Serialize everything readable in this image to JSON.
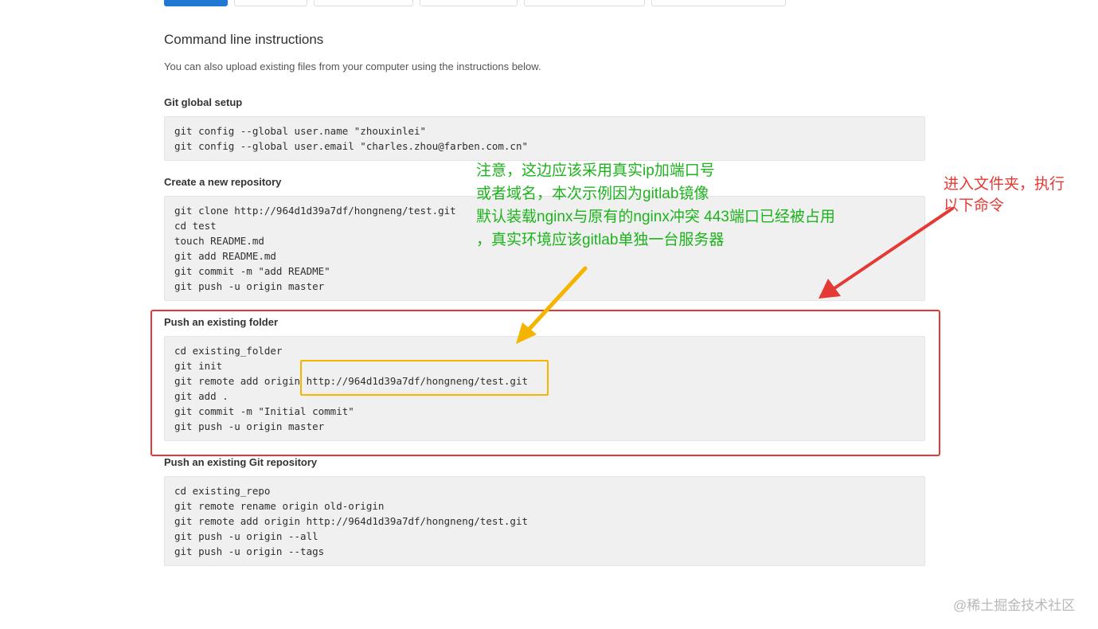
{
  "header": {
    "title": "Command line instructions",
    "description": "You can also upload existing files from your computer using the instructions below."
  },
  "sections": [
    {
      "title": "Git global setup",
      "lines": [
        "git config --global user.name \"zhouxinlei\"",
        "git config --global user.email \"charles.zhou@farben.com.cn\""
      ]
    },
    {
      "title": "Create a new repository",
      "lines": [
        "git clone http://964d1d39a7df/hongneng/test.git",
        "cd test",
        "touch README.md",
        "git add README.md",
        "git commit -m \"add README\"",
        "git push -u origin master"
      ]
    },
    {
      "title": "Push an existing folder",
      "lines": [
        "cd existing_folder",
        "git init",
        "git remote add origin http://964d1d39a7df/hongneng/test.git",
        "git add .",
        "git commit -m \"Initial commit\"",
        "git push -u origin master"
      ]
    },
    {
      "title": "Push an existing Git repository",
      "lines": [
        "cd existing_repo",
        "git remote rename origin old-origin",
        "git remote add origin http://964d1d39a7df/hongneng/test.git",
        "git push -u origin --all",
        "git push -u origin --tags"
      ]
    }
  ],
  "annotations": {
    "green_note": [
      "注意，这边应该采用真实ip加端口号",
      "或者域名，本次示例因为gitlab镜像",
      "默认装载nginx与原有的nginx冲突 443端口已经被占用",
      "，真实环境应该gitlab单独一台服务器"
    ],
    "red_note": [
      "进入文件夹，执行",
      "以下命令"
    ],
    "colors": {
      "green": "#1db31d",
      "red": "#e53935",
      "yellow": "#f5b400"
    }
  },
  "watermark": "@稀土掘金技术社区"
}
